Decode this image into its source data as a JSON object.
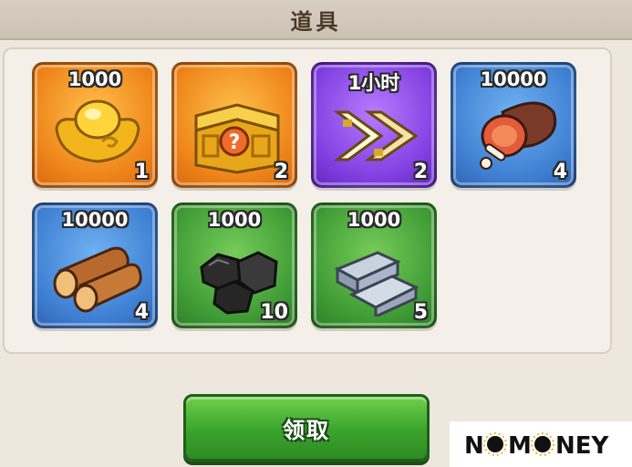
{
  "header": {
    "title": "道具"
  },
  "items": [
    {
      "name": "gold-ingot",
      "top_amount": "1000",
      "count": "1",
      "theme": "orange"
    },
    {
      "name": "mystery-chest",
      "top_amount": "",
      "count": "2",
      "theme": "orange"
    },
    {
      "name": "speedup",
      "top_amount": "1小时",
      "count": "2",
      "theme": "purple"
    },
    {
      "name": "meat",
      "top_amount": "10000",
      "count": "4",
      "theme": "blue"
    },
    {
      "name": "wood",
      "top_amount": "10000",
      "count": "4",
      "theme": "blue"
    },
    {
      "name": "coal",
      "top_amount": "1000",
      "count": "10",
      "theme": "green"
    },
    {
      "name": "iron",
      "top_amount": "1000",
      "count": "5",
      "theme": "green"
    }
  ],
  "claim_button": {
    "label": "领取"
  },
  "logo": {
    "text": "NOMONEY"
  },
  "colors": {
    "orange_slot": "#ee8319",
    "purple_slot": "#7f3fe0",
    "blue_slot": "#3f7fd2",
    "green_slot": "#3f9b35",
    "button_green": "#3aa32c"
  }
}
